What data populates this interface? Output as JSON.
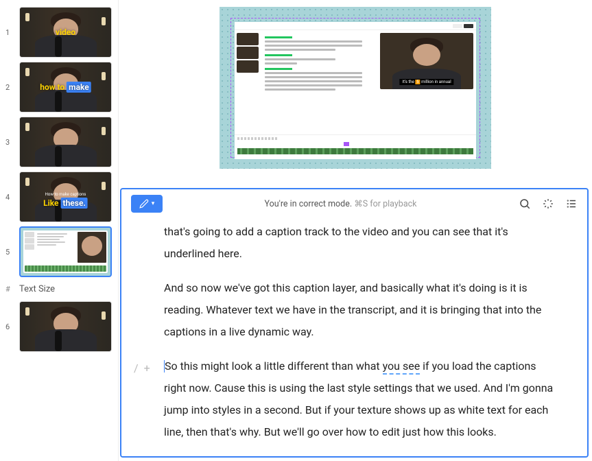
{
  "sidebar": {
    "text_size_label": "Text Size",
    "hash_symbol": "#",
    "items": [
      {
        "index": "1",
        "caption_parts": [
          {
            "text": "video",
            "style": "yellow"
          }
        ]
      },
      {
        "index": "2",
        "caption_parts": [
          {
            "text": "how to ",
            "style": "yellow"
          },
          {
            "text": "make",
            "style": "blue"
          }
        ]
      },
      {
        "index": "3",
        "caption_parts": []
      },
      {
        "index": "4",
        "small_caption": "How to make captions",
        "caption_parts": [
          {
            "text": "Like ",
            "style": "white"
          },
          {
            "text": "these.",
            "style": "blue"
          }
        ]
      },
      {
        "index": "5",
        "type": "editor",
        "selected": true
      },
      {
        "index": "6",
        "caption_parts": [
          {
            "text": "",
            "style": "white"
          }
        ]
      }
    ]
  },
  "preview": {
    "video_caption_prefix": "It's the ",
    "video_caption_highlight": "5",
    "video_caption_suffix": " million in annual"
  },
  "toolbar": {
    "mode_text": "You're in correct mode.",
    "shortcut_text": "⌘S for playback"
  },
  "transcript": {
    "para1": "that's going to add a caption track to the video and you can see that it's underlined here.",
    "para2": "And so now we've got this caption layer, and basically what it's doing is it is reading. Whatever text we have in the transcript, and it is bringing that into the captions in a live dynamic way.",
    "para3_a": "So this might look a little different than what ",
    "para3_link": "you see",
    "para3_b": " if you load the captions right now. Cause this is using the last style settings that we used. And I'm gonna jump into styles in a second. But if your texture shows up as white text for each line, then that's why. But we'll go over how to edit just how this looks.",
    "handle_slash": "/",
    "handle_plus": "+"
  }
}
